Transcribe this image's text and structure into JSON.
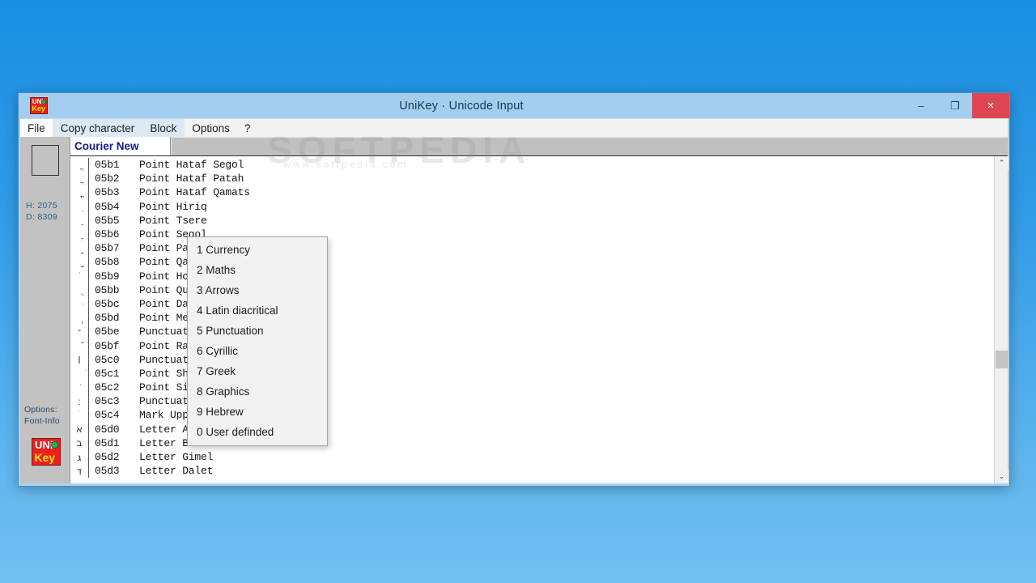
{
  "desktop": {
    "background_top": "#1a8fe0",
    "background_bottom": "#74c0f0"
  },
  "watermark": {
    "text": "SOFTPEDIA",
    "subtext": "www.softpedia.com"
  },
  "window": {
    "title": "UniKey · Unicode Input",
    "icon": "unikey-logo-icon",
    "controls": {
      "minimize": "–",
      "maximize": "❐",
      "close": "×",
      "close_color": "#e04552"
    }
  },
  "menubar": {
    "items": [
      {
        "label": "File",
        "name": "menu-file",
        "state": "white"
      },
      {
        "label": "Copy character",
        "name": "menu-copy-character",
        "state": "raised"
      },
      {
        "label": "Block",
        "name": "menu-block",
        "state": "raised"
      },
      {
        "label": "Options",
        "name": "menu-options",
        "state": "plain"
      },
      {
        "label": "?",
        "name": "menu-help",
        "state": "plain"
      }
    ]
  },
  "block_menu": {
    "open": true,
    "parent": "Block",
    "items": [
      "1 Currency",
      "2 Maths",
      "3 Arrows",
      "4 Latin diacritical",
      "5 Punctuation",
      "6 Cyrillic",
      "7 Greek",
      "8 Graphics",
      "9 Hebrew",
      "0 User definded"
    ]
  },
  "sidebar": {
    "preview_char": "",
    "hex_label": "H: 2075",
    "dec_label": "D: 8309",
    "options_label": "Options:",
    "fontinfo_label": "Font-Info",
    "logo": {
      "top_text": "UNi",
      "bottom_text": "Key",
      "bg_color": "#e8201f",
      "top_color": "#ffffff",
      "bottom_color": "#ffe400",
      "globe_color": "#16b65c"
    }
  },
  "main": {
    "font_name": "Courier New",
    "rows": [
      {
        "glyph": "ֱ",
        "code": "05b1",
        "desc": "Point Hataf Segol"
      },
      {
        "glyph": "ֲ",
        "code": "05b2",
        "desc": "Point Hataf Patah"
      },
      {
        "glyph": "ֳ",
        "code": "05b3",
        "desc": "Point Hataf Qamats"
      },
      {
        "glyph": "ִ",
        "code": "05b4",
        "desc": "Point Hiriq"
      },
      {
        "glyph": "ֵ",
        "code": "05b5",
        "desc": "Point Tsere"
      },
      {
        "glyph": "ֶ",
        "code": "05b6",
        "desc": "Point Segol"
      },
      {
        "glyph": "ַ",
        "code": "05b7",
        "desc": "Point Patah"
      },
      {
        "glyph": "ָ",
        "code": "05b8",
        "desc": "Point Qamats"
      },
      {
        "glyph": "ֹ",
        "code": "05b9",
        "desc": "Point Holam"
      },
      {
        "glyph": "ֻ",
        "code": "05bb",
        "desc": "Point Qubuts"
      },
      {
        "glyph": "ּ",
        "code": "05bc",
        "desc": "Point Dagesh"
      },
      {
        "glyph": "ֽ",
        "code": "05bd",
        "desc": "Point Meteg"
      },
      {
        "glyph": "־",
        "code": "05be",
        "desc": "Punctuation Maqaf"
      },
      {
        "glyph": "ֿ",
        "code": "05bf",
        "desc": "Point Rafe"
      },
      {
        "glyph": "׀",
        "code": "05c0",
        "desc": "Punctuation Paseq"
      },
      {
        "glyph": "ׁ",
        "code": "05c1",
        "desc": "Point Shin Dot"
      },
      {
        "glyph": "ׂ",
        "code": "05c2",
        "desc": "Point Sin Dot"
      },
      {
        "glyph": "׃",
        "code": "05c3",
        "desc": "Punctuation Sof Pasuq"
      },
      {
        "glyph": "ׄ",
        "code": "05c4",
        "desc": "Mark Upper Dot"
      },
      {
        "glyph": "א",
        "code": "05d0",
        "desc": "Letter Alef"
      },
      {
        "glyph": "ב",
        "code": "05d1",
        "desc": "Letter Bet"
      },
      {
        "glyph": "ג",
        "code": "05d2",
        "desc": "Letter Gimel"
      },
      {
        "glyph": "ד",
        "code": "05d3",
        "desc": "Letter Dalet"
      }
    ]
  },
  "scrollbar": {
    "up_arrow": "⌃",
    "down_arrow": "⌄",
    "thumb_position_pct": 64
  }
}
